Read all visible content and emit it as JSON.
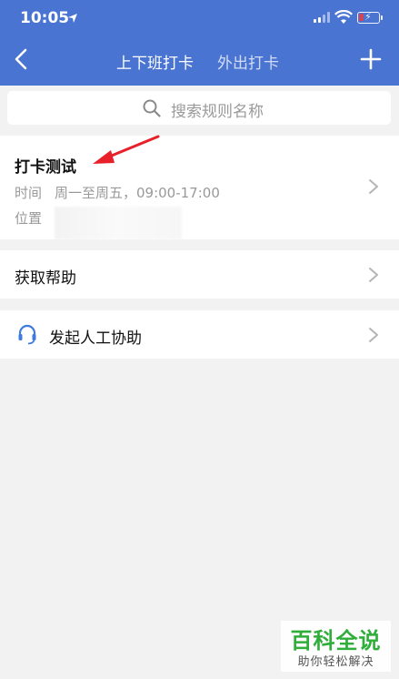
{
  "status_bar": {
    "time": "10:05"
  },
  "nav": {
    "tabs": [
      {
        "label": "上下班打卡",
        "active": true
      },
      {
        "label": "外出打卡",
        "active": false
      }
    ]
  },
  "search": {
    "placeholder": "搜索规则名称"
  },
  "rule": {
    "title": "打卡测试",
    "time_label": "时间",
    "time_value": "周一至周五，09:00-17:00",
    "location_label": "位置"
  },
  "help": {
    "label": "获取帮助"
  },
  "assist": {
    "label": "发起人工协助"
  },
  "watermark": {
    "title": "百科全说",
    "subtitle": "助你轻松解决"
  },
  "colors": {
    "header_bg": "#4a74d1",
    "annotation_arrow": "#e8202a",
    "assist_icon": "#3f7ae0",
    "watermark_green": "#2fae3a"
  }
}
